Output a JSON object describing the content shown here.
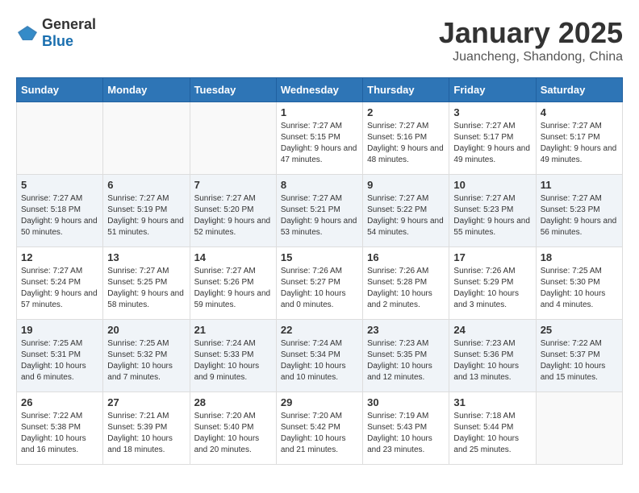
{
  "logo": {
    "general": "General",
    "blue": "Blue"
  },
  "header": {
    "title": "January 2025",
    "subtitle": "Juancheng, Shandong, China"
  },
  "weekdays": [
    "Sunday",
    "Monday",
    "Tuesday",
    "Wednesday",
    "Thursday",
    "Friday",
    "Saturday"
  ],
  "weeks": [
    [
      {
        "day": "",
        "content": ""
      },
      {
        "day": "",
        "content": ""
      },
      {
        "day": "",
        "content": ""
      },
      {
        "day": "1",
        "content": "Sunrise: 7:27 AM\nSunset: 5:15 PM\nDaylight: 9 hours and 47 minutes."
      },
      {
        "day": "2",
        "content": "Sunrise: 7:27 AM\nSunset: 5:16 PM\nDaylight: 9 hours and 48 minutes."
      },
      {
        "day": "3",
        "content": "Sunrise: 7:27 AM\nSunset: 5:17 PM\nDaylight: 9 hours and 49 minutes."
      },
      {
        "day": "4",
        "content": "Sunrise: 7:27 AM\nSunset: 5:17 PM\nDaylight: 9 hours and 49 minutes."
      }
    ],
    [
      {
        "day": "5",
        "content": "Sunrise: 7:27 AM\nSunset: 5:18 PM\nDaylight: 9 hours and 50 minutes."
      },
      {
        "day": "6",
        "content": "Sunrise: 7:27 AM\nSunset: 5:19 PM\nDaylight: 9 hours and 51 minutes."
      },
      {
        "day": "7",
        "content": "Sunrise: 7:27 AM\nSunset: 5:20 PM\nDaylight: 9 hours and 52 minutes."
      },
      {
        "day": "8",
        "content": "Sunrise: 7:27 AM\nSunset: 5:21 PM\nDaylight: 9 hours and 53 minutes."
      },
      {
        "day": "9",
        "content": "Sunrise: 7:27 AM\nSunset: 5:22 PM\nDaylight: 9 hours and 54 minutes."
      },
      {
        "day": "10",
        "content": "Sunrise: 7:27 AM\nSunset: 5:23 PM\nDaylight: 9 hours and 55 minutes."
      },
      {
        "day": "11",
        "content": "Sunrise: 7:27 AM\nSunset: 5:23 PM\nDaylight: 9 hours and 56 minutes."
      }
    ],
    [
      {
        "day": "12",
        "content": "Sunrise: 7:27 AM\nSunset: 5:24 PM\nDaylight: 9 hours and 57 minutes."
      },
      {
        "day": "13",
        "content": "Sunrise: 7:27 AM\nSunset: 5:25 PM\nDaylight: 9 hours and 58 minutes."
      },
      {
        "day": "14",
        "content": "Sunrise: 7:27 AM\nSunset: 5:26 PM\nDaylight: 9 hours and 59 minutes."
      },
      {
        "day": "15",
        "content": "Sunrise: 7:26 AM\nSunset: 5:27 PM\nDaylight: 10 hours and 0 minutes."
      },
      {
        "day": "16",
        "content": "Sunrise: 7:26 AM\nSunset: 5:28 PM\nDaylight: 10 hours and 2 minutes."
      },
      {
        "day": "17",
        "content": "Sunrise: 7:26 AM\nSunset: 5:29 PM\nDaylight: 10 hours and 3 minutes."
      },
      {
        "day": "18",
        "content": "Sunrise: 7:25 AM\nSunset: 5:30 PM\nDaylight: 10 hours and 4 minutes."
      }
    ],
    [
      {
        "day": "19",
        "content": "Sunrise: 7:25 AM\nSunset: 5:31 PM\nDaylight: 10 hours and 6 minutes."
      },
      {
        "day": "20",
        "content": "Sunrise: 7:25 AM\nSunset: 5:32 PM\nDaylight: 10 hours and 7 minutes."
      },
      {
        "day": "21",
        "content": "Sunrise: 7:24 AM\nSunset: 5:33 PM\nDaylight: 10 hours and 9 minutes."
      },
      {
        "day": "22",
        "content": "Sunrise: 7:24 AM\nSunset: 5:34 PM\nDaylight: 10 hours and 10 minutes."
      },
      {
        "day": "23",
        "content": "Sunrise: 7:23 AM\nSunset: 5:35 PM\nDaylight: 10 hours and 12 minutes."
      },
      {
        "day": "24",
        "content": "Sunrise: 7:23 AM\nSunset: 5:36 PM\nDaylight: 10 hours and 13 minutes."
      },
      {
        "day": "25",
        "content": "Sunrise: 7:22 AM\nSunset: 5:37 PM\nDaylight: 10 hours and 15 minutes."
      }
    ],
    [
      {
        "day": "26",
        "content": "Sunrise: 7:22 AM\nSunset: 5:38 PM\nDaylight: 10 hours and 16 minutes."
      },
      {
        "day": "27",
        "content": "Sunrise: 7:21 AM\nSunset: 5:39 PM\nDaylight: 10 hours and 18 minutes."
      },
      {
        "day": "28",
        "content": "Sunrise: 7:20 AM\nSunset: 5:40 PM\nDaylight: 10 hours and 20 minutes."
      },
      {
        "day": "29",
        "content": "Sunrise: 7:20 AM\nSunset: 5:42 PM\nDaylight: 10 hours and 21 minutes."
      },
      {
        "day": "30",
        "content": "Sunrise: 7:19 AM\nSunset: 5:43 PM\nDaylight: 10 hours and 23 minutes."
      },
      {
        "day": "31",
        "content": "Sunrise: 7:18 AM\nSunset: 5:44 PM\nDaylight: 10 hours and 25 minutes."
      },
      {
        "day": "",
        "content": ""
      }
    ]
  ]
}
